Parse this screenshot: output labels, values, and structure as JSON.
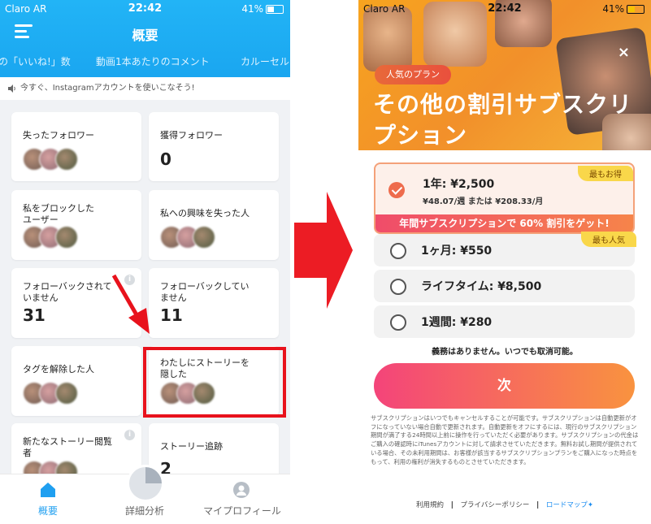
{
  "left": {
    "status": {
      "carrier": "Claro AR",
      "time": "22:42",
      "battery": "41%"
    },
    "title": "概要",
    "metrics": [
      "の「いいね!」数",
      "動画1本あたりのコメント",
      "カルーセル"
    ],
    "announcement": "今すぐ、Instagramアカウントを使いこなそう!",
    "cards": [
      {
        "title": "失ったフォロワー",
        "value": ""
      },
      {
        "title": "獲得フォロワー",
        "value": "0"
      },
      {
        "title": "私をブロックした\nユーザー",
        "value": ""
      },
      {
        "title": "私への興味を失った人",
        "value": ""
      },
      {
        "title": "フォローバックされて\nいません",
        "value": "31"
      },
      {
        "title": "フォローバックしてい\nません",
        "value": "11"
      },
      {
        "title": "タグを解除した人",
        "value": ""
      },
      {
        "title": "わたしにストーリーを\n隠した",
        "value": ""
      },
      {
        "title": "新たなストーリー閲覧\n者",
        "value": ""
      },
      {
        "title": "ストーリー追跡",
        "value": "2"
      }
    ],
    "info_glyph": "i",
    "tabs": [
      {
        "label": "概要",
        "icon": "home-icon"
      },
      {
        "label": "詳細分析",
        "icon": "pie-chart-icon"
      },
      {
        "label": "マイプロフィール",
        "icon": "profile-icon"
      }
    ]
  },
  "right": {
    "status": {
      "carrier": "Claro AR",
      "time": "22:42",
      "battery": "41%"
    },
    "popular_badge": "人気のプラン",
    "headline": "その他の割引サブスクリプション",
    "close": "×",
    "plans": [
      {
        "label": "1年: ¥2,500",
        "sub": "¥48.07/週 または ¥208.33/月",
        "badge": "最もお得",
        "promo": "年間サブスクリプションで 60% 割引をゲット!",
        "selected": true
      },
      {
        "label": "1ヶ月: ¥550",
        "badge": "最も人気",
        "selected": false
      },
      {
        "label": "ライフタイム: ¥8,500",
        "selected": false
      },
      {
        "label": "1週間: ¥280",
        "selected": false
      }
    ],
    "no_commitment": "義務はありません。いつでも取消可能。",
    "next_button": "次",
    "legal": "サブスクリプションはいつでもキャンセルすることが可能です。サブスクリプションは自動更新がオフになっていない場合自動で更新されます。自動更新をオフにするには、現行のサブスクリプション期間が満了する24時間以上前に操作を行っていただく必要があります。サブスクリプションの代金はご購入の確認時にiTunesアカウントに対して請求させていただきます。無料お試し期間が提供されている場合、その未利用期間は、お客様が該当するサブスクリプションプランをご購入になった時点をもって、利用の権利が消失するものとさせていただきます。",
    "links": {
      "terms": "利用規約",
      "privacy": "プライバシーポリシー",
      "roadmap": "ロードマップ",
      "sep": "|"
    }
  },
  "colors": {
    "accent_blue": "#1aa6f0",
    "highlight_red": "#e8121c",
    "cta_start": "#f4447a",
    "cta_end": "#f9933f"
  }
}
